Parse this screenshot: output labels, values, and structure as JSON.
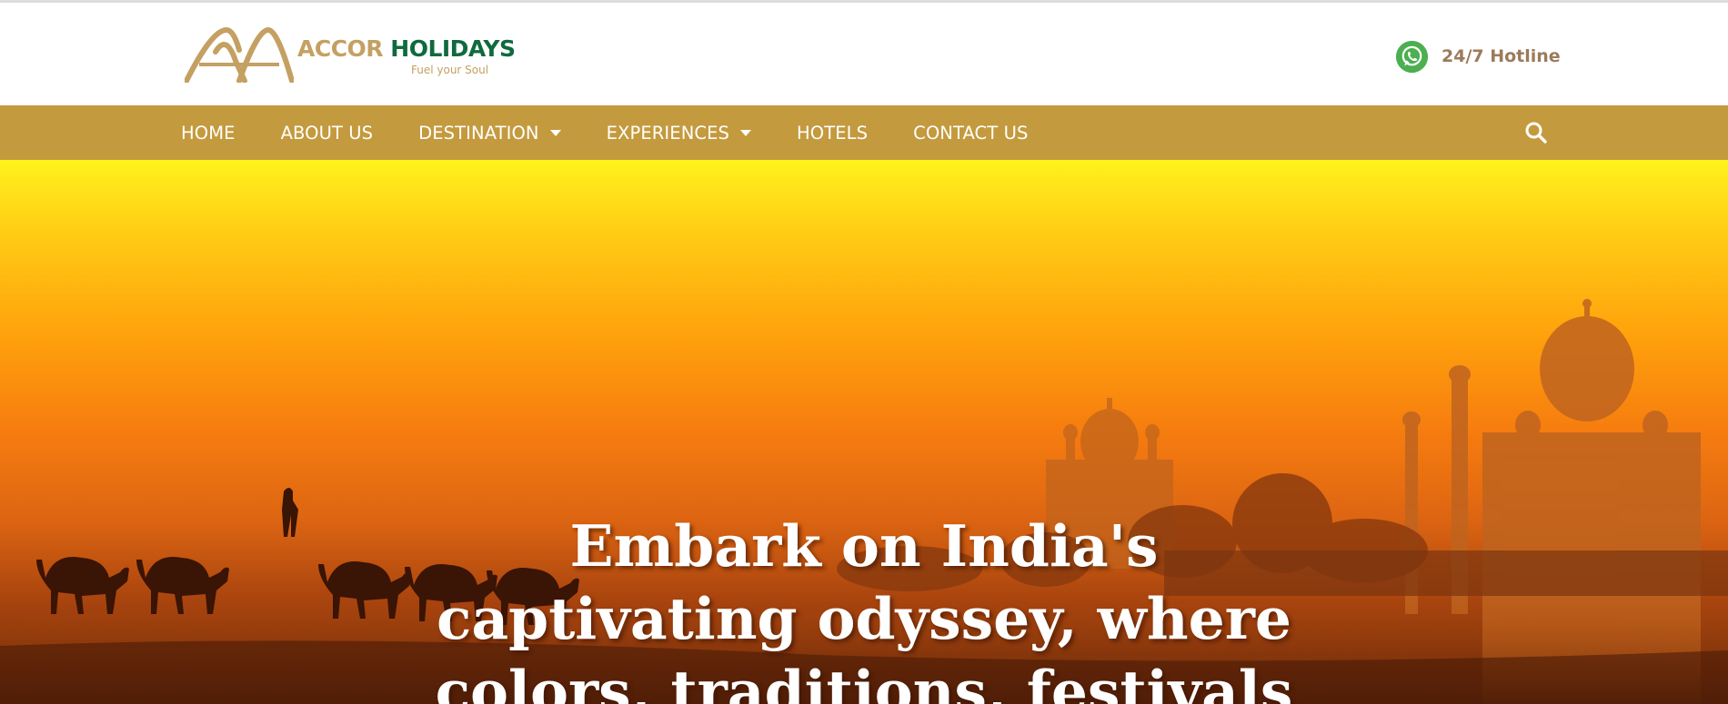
{
  "header": {
    "brand_part1": "ACCOR",
    "brand_part2": "HOLIDAYS",
    "tagline": "Fuel your Soul",
    "hotline_label": "24/7 Hotline",
    "hotline_icon": "whatsapp-icon"
  },
  "nav": {
    "items": [
      {
        "label": "HOME",
        "has_dropdown": false
      },
      {
        "label": "ABOUT US",
        "has_dropdown": false
      },
      {
        "label": "DESTINATION",
        "has_dropdown": true
      },
      {
        "label": "EXPERIENCES",
        "has_dropdown": true
      },
      {
        "label": "HOTELS",
        "has_dropdown": false
      },
      {
        "label": "CONTACT US",
        "has_dropdown": false
      }
    ],
    "search_icon": "search-icon"
  },
  "hero": {
    "title": "Embark on India's captivating odyssey, where colors, traditions, festivals"
  },
  "colors": {
    "nav_background": "#c49a3e",
    "brand_gold": "#c4a062",
    "brand_green": "#0f6a3d",
    "hotline_text": "#9b7b5a",
    "whatsapp_green": "#4caf50"
  }
}
